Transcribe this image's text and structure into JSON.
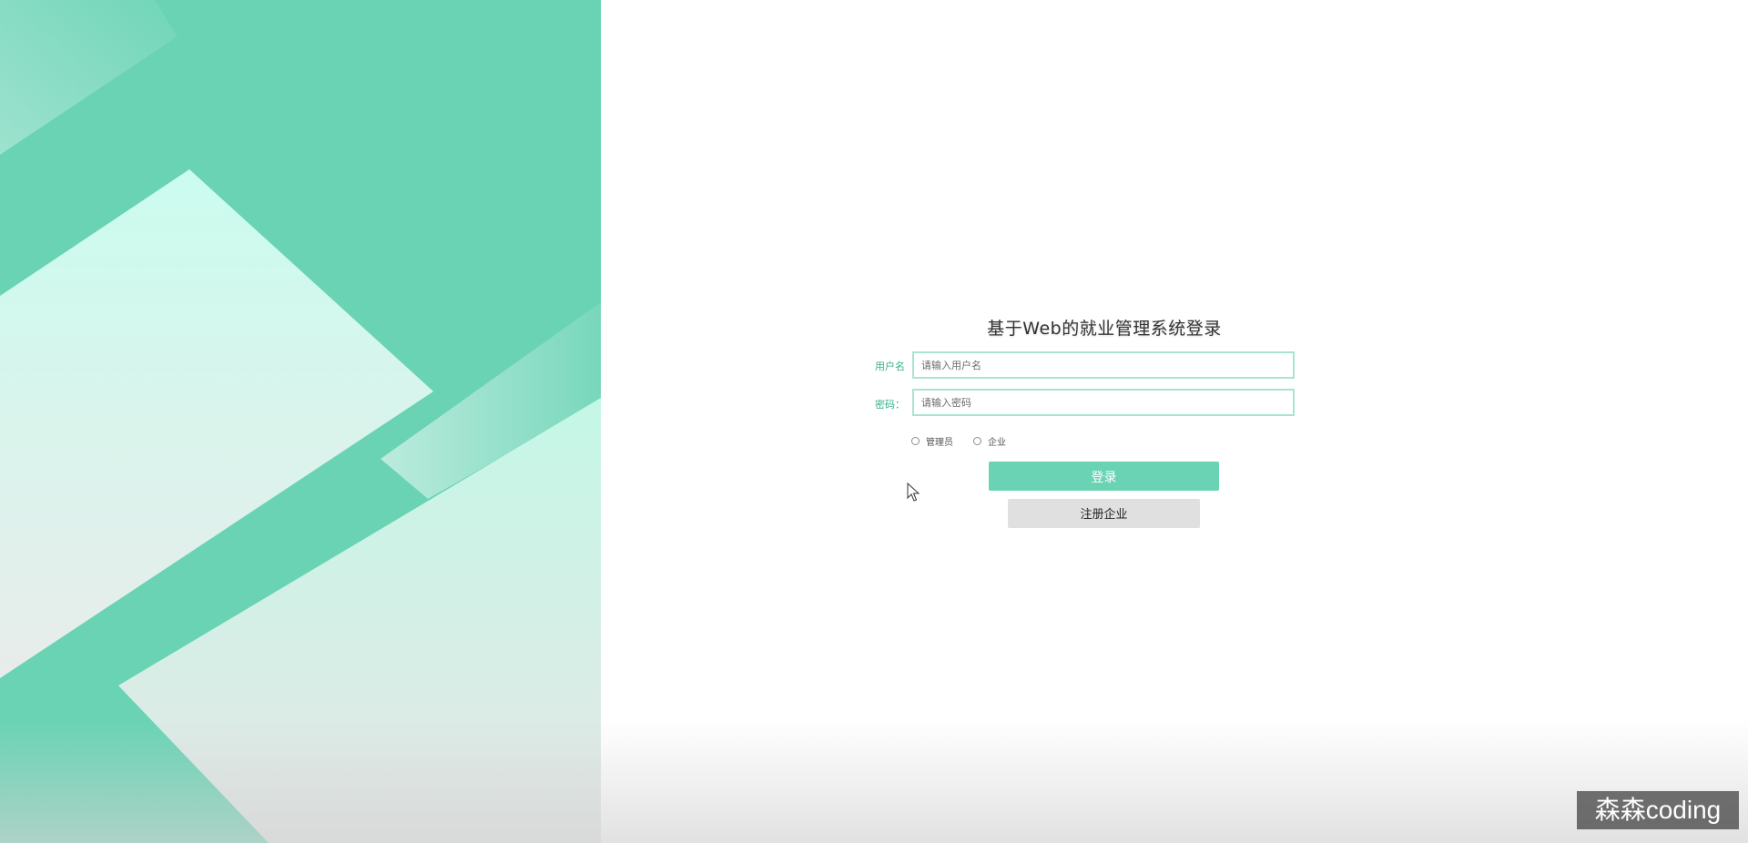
{
  "login": {
    "title": "基于Web的就业管理系统登录",
    "username_label": "用户名",
    "username_placeholder": "请输入用户名",
    "username_value": "",
    "password_label": "密码：",
    "password_placeholder": "请输入密码",
    "password_value": "",
    "roles": [
      {
        "label": "管理员",
        "selected": false
      },
      {
        "label": "企业",
        "selected": false
      }
    ],
    "login_button": "登录",
    "register_button": "注册企业"
  },
  "watermark": {
    "text": "森森coding"
  },
  "theme": {
    "accent": "#69d3b4",
    "accent_light": "#c8f8ea",
    "input_border": "#a9e4d2",
    "secondary_button": "#e0e0e0"
  },
  "icons": {
    "cursor": "mouse-pointer-icon",
    "radio": "radio-circle-icon"
  }
}
